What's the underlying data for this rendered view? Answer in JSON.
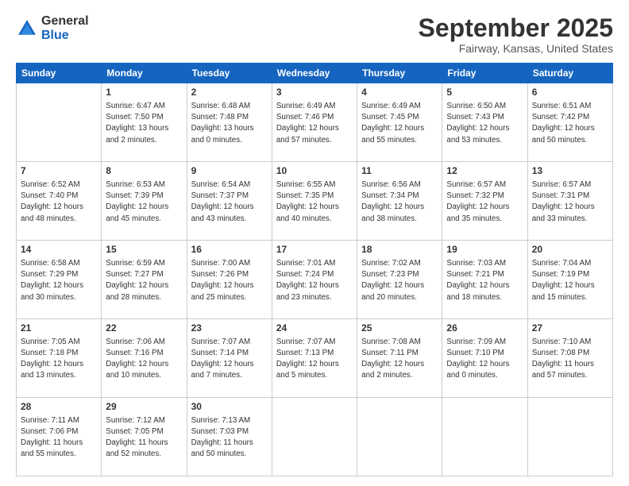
{
  "logo": {
    "line1": "General",
    "line2": "Blue"
  },
  "title": "September 2025",
  "subtitle": "Fairway, Kansas, United States",
  "days_of_week": [
    "Sunday",
    "Monday",
    "Tuesday",
    "Wednesday",
    "Thursday",
    "Friday",
    "Saturday"
  ],
  "weeks": [
    [
      {
        "day": "",
        "sunrise": "",
        "sunset": "",
        "daylight": ""
      },
      {
        "day": "1",
        "sunrise": "Sunrise: 6:47 AM",
        "sunset": "Sunset: 7:50 PM",
        "daylight": "Daylight: 13 hours and 2 minutes."
      },
      {
        "day": "2",
        "sunrise": "Sunrise: 6:48 AM",
        "sunset": "Sunset: 7:48 PM",
        "daylight": "Daylight: 13 hours and 0 minutes."
      },
      {
        "day": "3",
        "sunrise": "Sunrise: 6:49 AM",
        "sunset": "Sunset: 7:46 PM",
        "daylight": "Daylight: 12 hours and 57 minutes."
      },
      {
        "day": "4",
        "sunrise": "Sunrise: 6:49 AM",
        "sunset": "Sunset: 7:45 PM",
        "daylight": "Daylight: 12 hours and 55 minutes."
      },
      {
        "day": "5",
        "sunrise": "Sunrise: 6:50 AM",
        "sunset": "Sunset: 7:43 PM",
        "daylight": "Daylight: 12 hours and 53 minutes."
      },
      {
        "day": "6",
        "sunrise": "Sunrise: 6:51 AM",
        "sunset": "Sunset: 7:42 PM",
        "daylight": "Daylight: 12 hours and 50 minutes."
      }
    ],
    [
      {
        "day": "7",
        "sunrise": "Sunrise: 6:52 AM",
        "sunset": "Sunset: 7:40 PM",
        "daylight": "Daylight: 12 hours and 48 minutes."
      },
      {
        "day": "8",
        "sunrise": "Sunrise: 6:53 AM",
        "sunset": "Sunset: 7:39 PM",
        "daylight": "Daylight: 12 hours and 45 minutes."
      },
      {
        "day": "9",
        "sunrise": "Sunrise: 6:54 AM",
        "sunset": "Sunset: 7:37 PM",
        "daylight": "Daylight: 12 hours and 43 minutes."
      },
      {
        "day": "10",
        "sunrise": "Sunrise: 6:55 AM",
        "sunset": "Sunset: 7:35 PM",
        "daylight": "Daylight: 12 hours and 40 minutes."
      },
      {
        "day": "11",
        "sunrise": "Sunrise: 6:56 AM",
        "sunset": "Sunset: 7:34 PM",
        "daylight": "Daylight: 12 hours and 38 minutes."
      },
      {
        "day": "12",
        "sunrise": "Sunrise: 6:57 AM",
        "sunset": "Sunset: 7:32 PM",
        "daylight": "Daylight: 12 hours and 35 minutes."
      },
      {
        "day": "13",
        "sunrise": "Sunrise: 6:57 AM",
        "sunset": "Sunset: 7:31 PM",
        "daylight": "Daylight: 12 hours and 33 minutes."
      }
    ],
    [
      {
        "day": "14",
        "sunrise": "Sunrise: 6:58 AM",
        "sunset": "Sunset: 7:29 PM",
        "daylight": "Daylight: 12 hours and 30 minutes."
      },
      {
        "day": "15",
        "sunrise": "Sunrise: 6:59 AM",
        "sunset": "Sunset: 7:27 PM",
        "daylight": "Daylight: 12 hours and 28 minutes."
      },
      {
        "day": "16",
        "sunrise": "Sunrise: 7:00 AM",
        "sunset": "Sunset: 7:26 PM",
        "daylight": "Daylight: 12 hours and 25 minutes."
      },
      {
        "day": "17",
        "sunrise": "Sunrise: 7:01 AM",
        "sunset": "Sunset: 7:24 PM",
        "daylight": "Daylight: 12 hours and 23 minutes."
      },
      {
        "day": "18",
        "sunrise": "Sunrise: 7:02 AM",
        "sunset": "Sunset: 7:23 PM",
        "daylight": "Daylight: 12 hours and 20 minutes."
      },
      {
        "day": "19",
        "sunrise": "Sunrise: 7:03 AM",
        "sunset": "Sunset: 7:21 PM",
        "daylight": "Daylight: 12 hours and 18 minutes."
      },
      {
        "day": "20",
        "sunrise": "Sunrise: 7:04 AM",
        "sunset": "Sunset: 7:19 PM",
        "daylight": "Daylight: 12 hours and 15 minutes."
      }
    ],
    [
      {
        "day": "21",
        "sunrise": "Sunrise: 7:05 AM",
        "sunset": "Sunset: 7:18 PM",
        "daylight": "Daylight: 12 hours and 13 minutes."
      },
      {
        "day": "22",
        "sunrise": "Sunrise: 7:06 AM",
        "sunset": "Sunset: 7:16 PM",
        "daylight": "Daylight: 12 hours and 10 minutes."
      },
      {
        "day": "23",
        "sunrise": "Sunrise: 7:07 AM",
        "sunset": "Sunset: 7:14 PM",
        "daylight": "Daylight: 12 hours and 7 minutes."
      },
      {
        "day": "24",
        "sunrise": "Sunrise: 7:07 AM",
        "sunset": "Sunset: 7:13 PM",
        "daylight": "Daylight: 12 hours and 5 minutes."
      },
      {
        "day": "25",
        "sunrise": "Sunrise: 7:08 AM",
        "sunset": "Sunset: 7:11 PM",
        "daylight": "Daylight: 12 hours and 2 minutes."
      },
      {
        "day": "26",
        "sunrise": "Sunrise: 7:09 AM",
        "sunset": "Sunset: 7:10 PM",
        "daylight": "Daylight: 12 hours and 0 minutes."
      },
      {
        "day": "27",
        "sunrise": "Sunrise: 7:10 AM",
        "sunset": "Sunset: 7:08 PM",
        "daylight": "Daylight: 11 hours and 57 minutes."
      }
    ],
    [
      {
        "day": "28",
        "sunrise": "Sunrise: 7:11 AM",
        "sunset": "Sunset: 7:06 PM",
        "daylight": "Daylight: 11 hours and 55 minutes."
      },
      {
        "day": "29",
        "sunrise": "Sunrise: 7:12 AM",
        "sunset": "Sunset: 7:05 PM",
        "daylight": "Daylight: 11 hours and 52 minutes."
      },
      {
        "day": "30",
        "sunrise": "Sunrise: 7:13 AM",
        "sunset": "Sunset: 7:03 PM",
        "daylight": "Daylight: 11 hours and 50 minutes."
      },
      {
        "day": "",
        "sunrise": "",
        "sunset": "",
        "daylight": ""
      },
      {
        "day": "",
        "sunrise": "",
        "sunset": "",
        "daylight": ""
      },
      {
        "day": "",
        "sunrise": "",
        "sunset": "",
        "daylight": ""
      },
      {
        "day": "",
        "sunrise": "",
        "sunset": "",
        "daylight": ""
      }
    ]
  ]
}
